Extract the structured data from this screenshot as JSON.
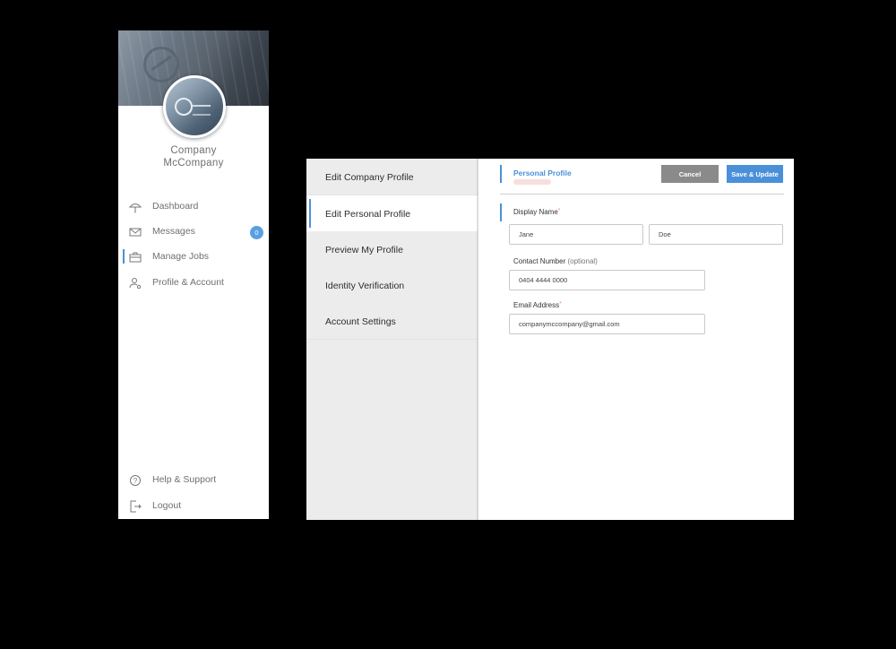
{
  "sidebar": {
    "company_name_line1": "Company",
    "company_name_line2": "McCompany",
    "nav": [
      {
        "label": "Dashboard",
        "icon": "umbrella-icon"
      },
      {
        "label": "Messages",
        "icon": "envelope-icon",
        "badge": "0"
      },
      {
        "label": "Manage Jobs",
        "icon": "briefcase-icon",
        "active": true
      },
      {
        "label": "Profile & Account",
        "icon": "user-settings-icon"
      }
    ],
    "footer_nav": [
      {
        "label": "Help & Support",
        "icon": "help-icon"
      },
      {
        "label": "Logout",
        "icon": "logout-icon"
      }
    ]
  },
  "menu": {
    "items": [
      {
        "label": "Edit Company Profile"
      },
      {
        "label": "Edit Personal Profile",
        "active": true
      },
      {
        "label": "Preview My Profile"
      },
      {
        "label": "Identity Verification"
      },
      {
        "label": "Account Settings"
      }
    ]
  },
  "form": {
    "section_title": "Personal Profile",
    "cancel_label": "Cancel",
    "save_label": "Save & Update",
    "display_name_label": "Display Name",
    "first_name_value": "Jane",
    "last_name_value": "Doe",
    "contact_label": "Contact Number",
    "contact_optional": "(optional)",
    "contact_value": "0404 4444 0000",
    "email_label": "Email Address",
    "email_value": "companymccompany@gmail.com",
    "required_mark": "*"
  },
  "colors": {
    "accent": "#4a90d9",
    "badge": "#5aa0e0",
    "cancel": "#8a8a8a",
    "menu_bg": "#ececec"
  }
}
